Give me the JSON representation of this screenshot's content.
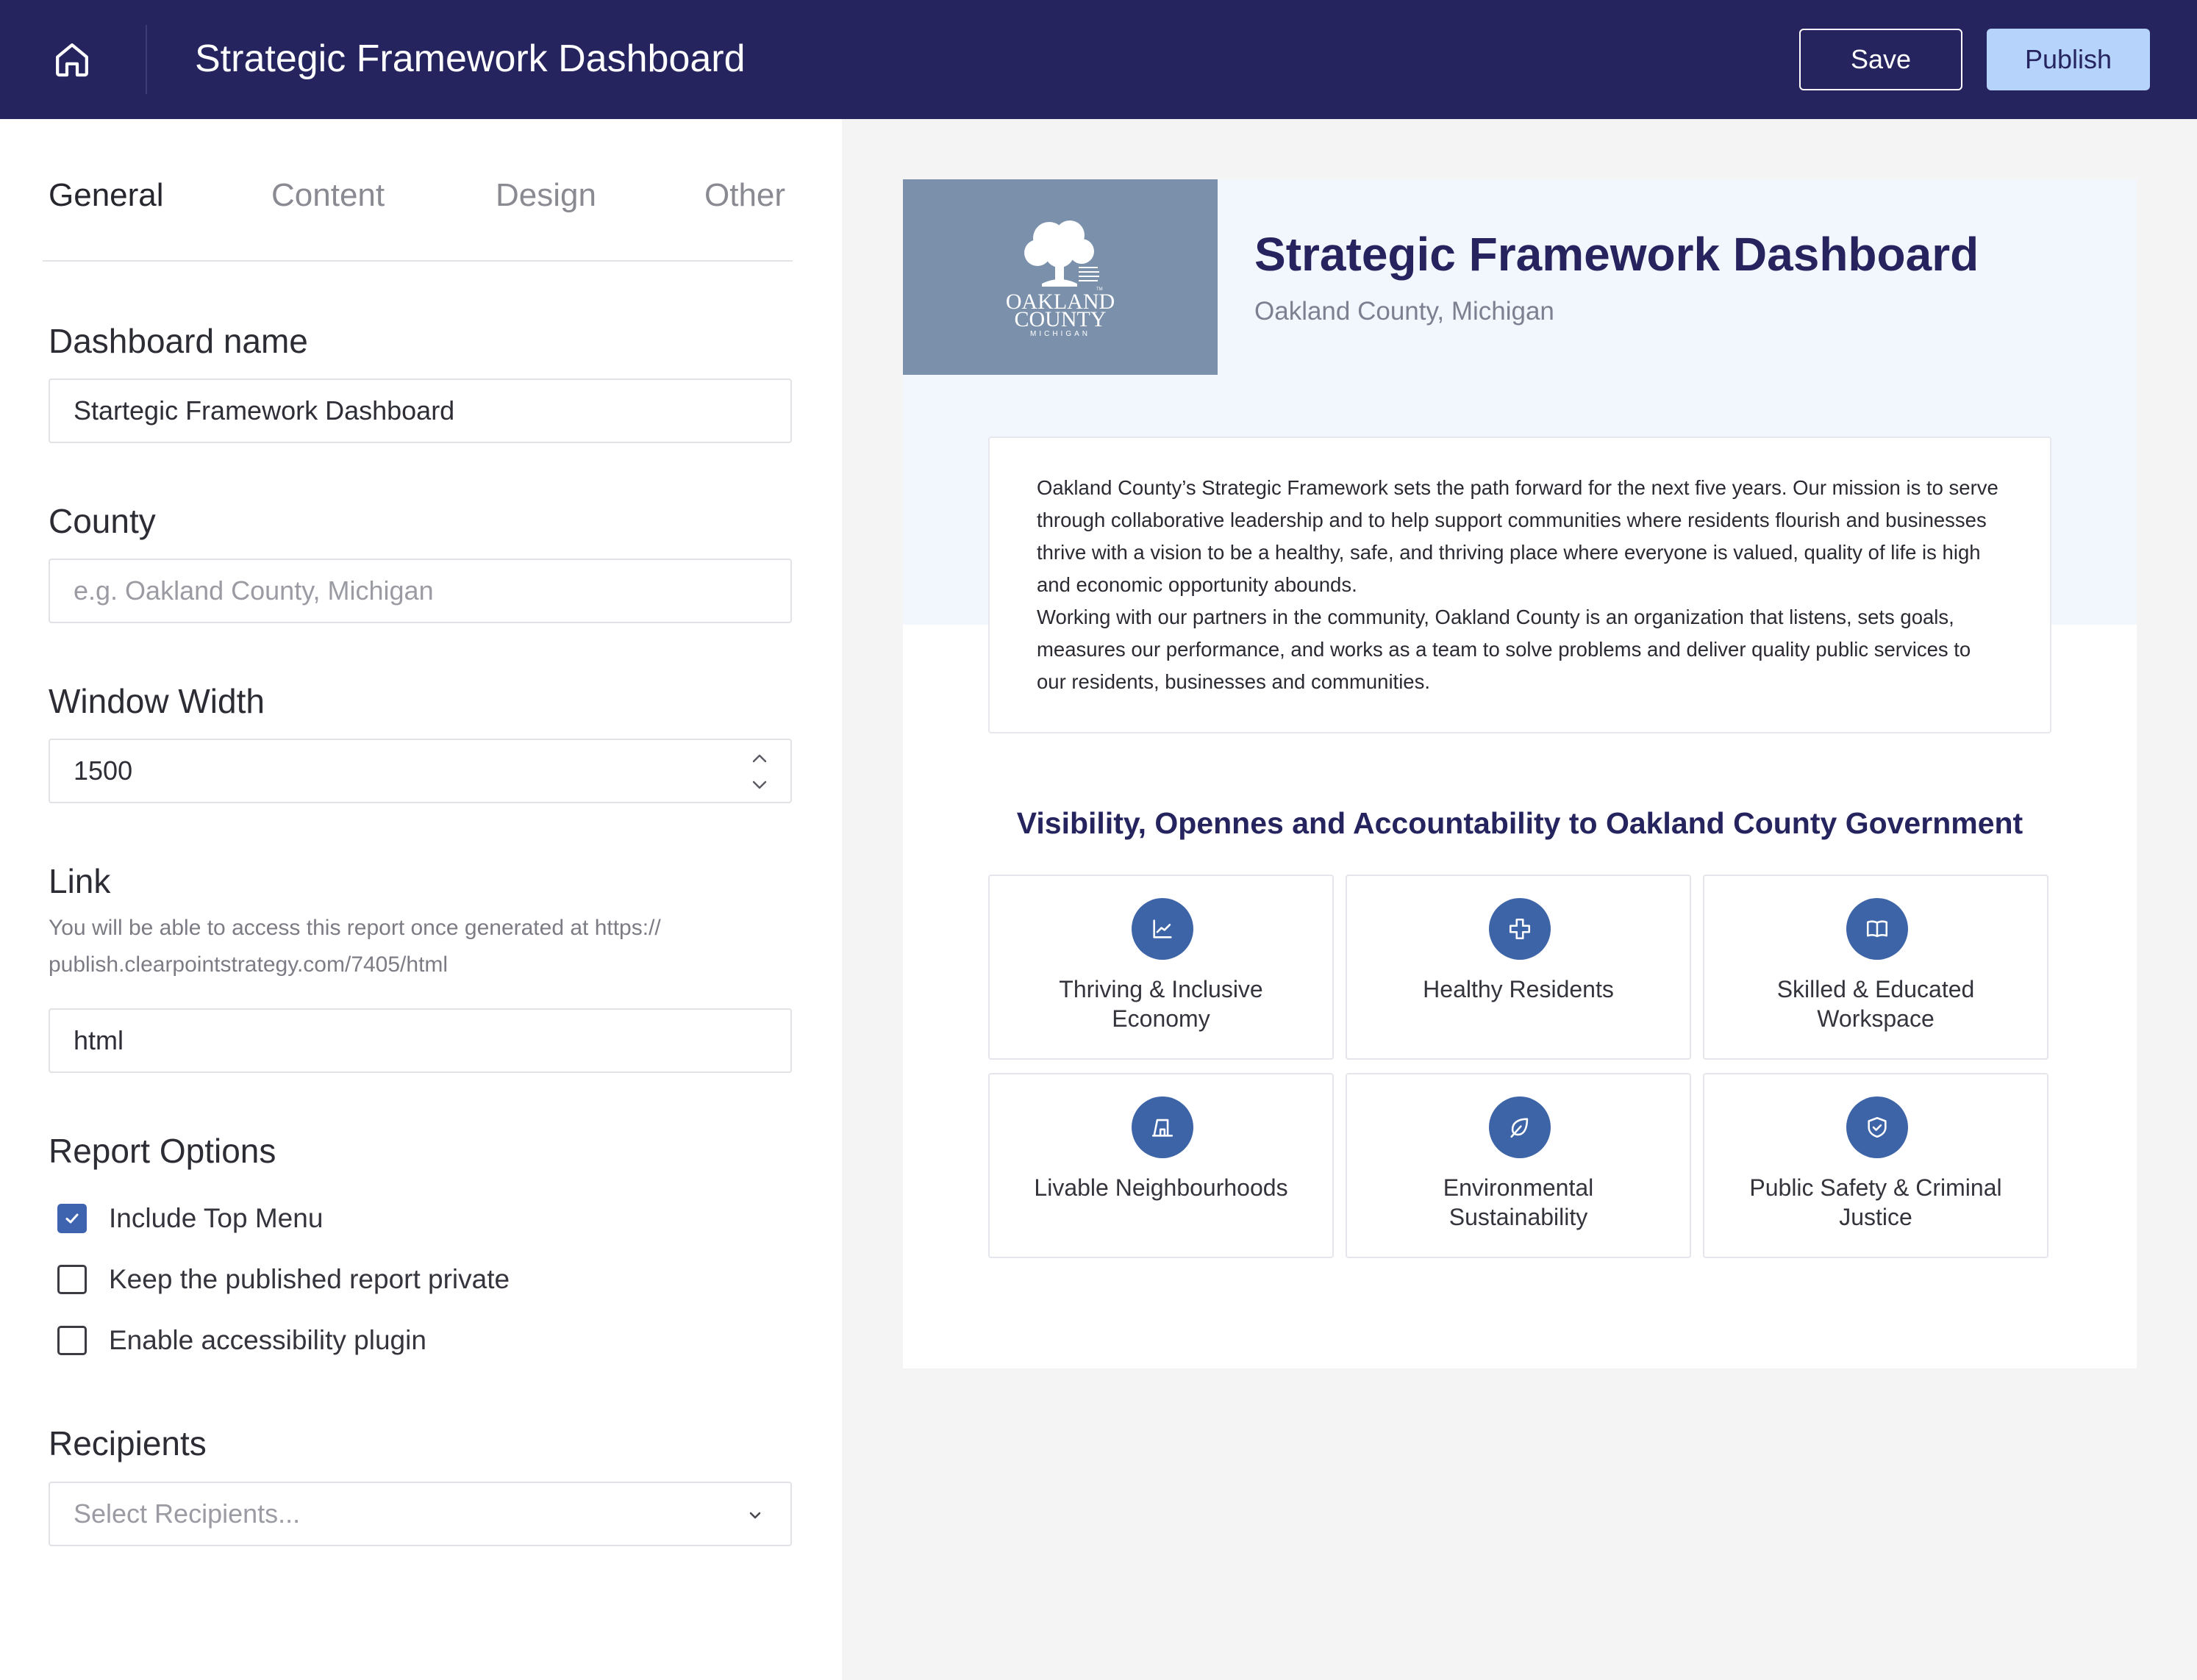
{
  "header": {
    "title": "Strategic Framework Dashboard",
    "save_label": "Save",
    "publish_label": "Publish",
    "icons": {
      "home": "home-icon"
    }
  },
  "tabs": [
    {
      "label": "General",
      "active": true
    },
    {
      "label": "Content",
      "active": false
    },
    {
      "label": "Design",
      "active": false
    },
    {
      "label": "Other",
      "active": false
    }
  ],
  "form": {
    "dashboard_name": {
      "label": "Dashboard name",
      "value": "Startegic Framework Dashboard"
    },
    "county": {
      "label": "County",
      "placeholder": "e.g. Oakland County, Michigan",
      "value": ""
    },
    "window_width": {
      "label": "Window Width",
      "value": "1500"
    },
    "link": {
      "label": "Link",
      "help": "You will be able to access this report once generated at https:// publish.clearpointstrategy.com/7405/html",
      "value": "html"
    },
    "report_options": {
      "label": "Report Options",
      "options": [
        {
          "label": "Include Top Menu",
          "checked": true
        },
        {
          "label": "Keep the published report private",
          "checked": false
        },
        {
          "label": "Enable accessibility plugin",
          "checked": false
        }
      ]
    },
    "recipients": {
      "label": "Recipients",
      "placeholder": "Select Recipients..."
    }
  },
  "preview": {
    "logo_text": {
      "line1": "OAKLAND",
      "line2": "COUNTY",
      "line3": "MICHIGAN",
      "tm": "TM"
    },
    "title": "Strategic Framework Dashboard",
    "subtitle": "Oakland County, Michigan",
    "description": [
      "Oakland County’s Strategic Framework sets the path forward for the next five years. Our mission is to serve through collaborative leadership and to help support communities where residents flourish and businesses thrive with a vision to be a healthy, safe, and thriving place where everyone is valued, quality of life is high and economic opportunity abounds.",
      "Working with our partners in the community, Oakland County is an organization that listens, sets goals, measures our performance, and works as a team to solve problems and deliver quality public services to our residents, businesses and communities."
    ],
    "section_heading": "Visibility, Opennes and Accountability to Oakland County Government",
    "tiles": [
      {
        "label": "Thriving & Inclusive Economy",
        "icon": "chart-line-icon"
      },
      {
        "label": "Healthy Residents",
        "icon": "medical-cross-icon"
      },
      {
        "label": "Skilled & Educated Workspace",
        "icon": "open-book-icon"
      },
      {
        "label": "Livable Neighbourhoods",
        "icon": "building-icon"
      },
      {
        "label": "Environmental Sustainability",
        "icon": "leaf-icon"
      },
      {
        "label": "Public Safety & Criminal Justice",
        "icon": "shield-check-icon"
      }
    ]
  },
  "colors": {
    "header_bg": "#26245f",
    "publish_bg": "#b6d3fb",
    "accent": "#3e64a8",
    "logo_bg": "#7a90ab",
    "preview_header_bg": "#f2f6fd"
  }
}
